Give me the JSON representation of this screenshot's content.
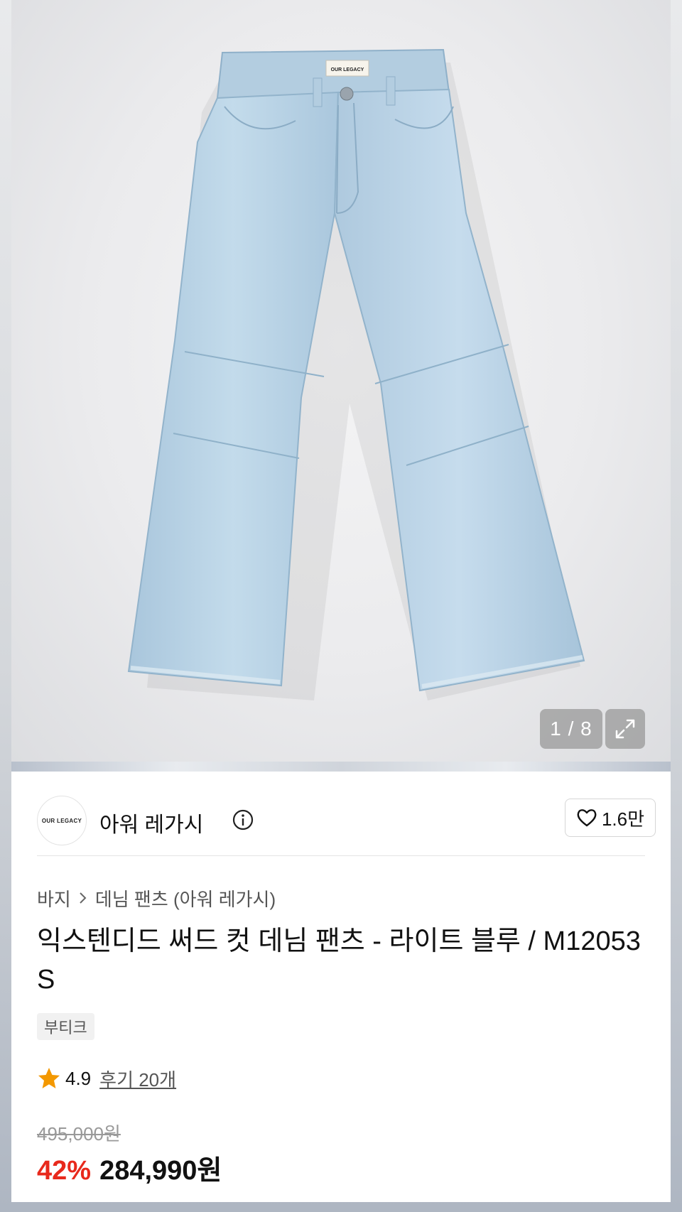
{
  "gallery": {
    "page_indicator": "1 / 8",
    "label_text": "OUR LEGACY",
    "icons": {
      "expand": "expand-arrows-icon"
    }
  },
  "brand": {
    "logo_text": "OUR LEGACY",
    "name": "아워 레가시",
    "like_count": "1.6만",
    "icons": {
      "info": "info-circle-icon",
      "like": "heart-outline-icon"
    }
  },
  "breadcrumb": {
    "category": "바지",
    "subcategory": "데님 팬츠 (아워 레가시)"
  },
  "product": {
    "title": "익스텐디드 써드 컷 데님 팬츠 - 라이트 블루 / M12053S",
    "tag": "부티크",
    "rating": "4.9",
    "reviews": "후기 20개"
  },
  "price": {
    "original": "495,000원",
    "discount": "42%",
    "sale": "284,990원"
  },
  "colors": {
    "discount_red": "#e8291c",
    "star_orange": "#f39800",
    "denim": "#b7d2e6"
  }
}
